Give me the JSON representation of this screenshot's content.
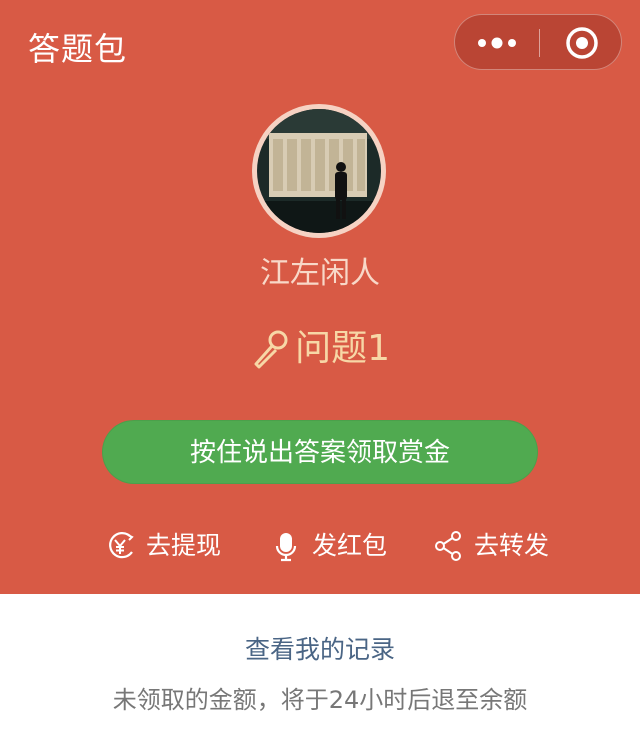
{
  "header": {
    "title": "答题包"
  },
  "capsule": {
    "menu_icon": "more-dots-icon",
    "close_icon": "target-close-icon"
  },
  "profile": {
    "username": "江左闲人"
  },
  "question": {
    "icon": "microphone-icon",
    "text": "问题1"
  },
  "main_button": {
    "label": "按住说出答案领取赏金"
  },
  "actions": [
    {
      "icon": "yen-withdraw-icon",
      "label": "去提现"
    },
    {
      "icon": "microphone-icon",
      "label": "发红包"
    },
    {
      "icon": "share-icon",
      "label": "去转发"
    }
  ],
  "footer": {
    "records_link": "查看我的记录",
    "note": "未领取的金额，将于24小时后退至余额"
  },
  "colors": {
    "banner": "#d85a45",
    "button": "#50aa50",
    "question_text": "#f7d7a6",
    "link": "#4a6585"
  }
}
